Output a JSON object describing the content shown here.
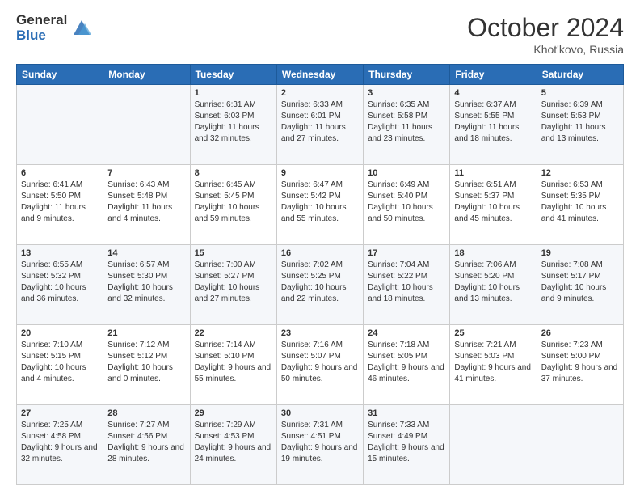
{
  "logo": {
    "general": "General",
    "blue": "Blue"
  },
  "header": {
    "month": "October 2024",
    "location": "Khot'kovo, Russia"
  },
  "weekdays": [
    "Sunday",
    "Monday",
    "Tuesday",
    "Wednesday",
    "Thursday",
    "Friday",
    "Saturday"
  ],
  "weeks": [
    [
      null,
      null,
      {
        "day": 1,
        "sunrise": "6:31 AM",
        "sunset": "6:03 PM",
        "daylight": "11 hours and 32 minutes."
      },
      {
        "day": 2,
        "sunrise": "6:33 AM",
        "sunset": "6:01 PM",
        "daylight": "11 hours and 27 minutes."
      },
      {
        "day": 3,
        "sunrise": "6:35 AM",
        "sunset": "5:58 PM",
        "daylight": "11 hours and 23 minutes."
      },
      {
        "day": 4,
        "sunrise": "6:37 AM",
        "sunset": "5:55 PM",
        "daylight": "11 hours and 18 minutes."
      },
      {
        "day": 5,
        "sunrise": "6:39 AM",
        "sunset": "5:53 PM",
        "daylight": "11 hours and 13 minutes."
      }
    ],
    [
      {
        "day": 6,
        "sunrise": "6:41 AM",
        "sunset": "5:50 PM",
        "daylight": "11 hours and 9 minutes."
      },
      {
        "day": 7,
        "sunrise": "6:43 AM",
        "sunset": "5:48 PM",
        "daylight": "11 hours and 4 minutes."
      },
      {
        "day": 8,
        "sunrise": "6:45 AM",
        "sunset": "5:45 PM",
        "daylight": "10 hours and 59 minutes."
      },
      {
        "day": 9,
        "sunrise": "6:47 AM",
        "sunset": "5:42 PM",
        "daylight": "10 hours and 55 minutes."
      },
      {
        "day": 10,
        "sunrise": "6:49 AM",
        "sunset": "5:40 PM",
        "daylight": "10 hours and 50 minutes."
      },
      {
        "day": 11,
        "sunrise": "6:51 AM",
        "sunset": "5:37 PM",
        "daylight": "10 hours and 45 minutes."
      },
      {
        "day": 12,
        "sunrise": "6:53 AM",
        "sunset": "5:35 PM",
        "daylight": "10 hours and 41 minutes."
      }
    ],
    [
      {
        "day": 13,
        "sunrise": "6:55 AM",
        "sunset": "5:32 PM",
        "daylight": "10 hours and 36 minutes."
      },
      {
        "day": 14,
        "sunrise": "6:57 AM",
        "sunset": "5:30 PM",
        "daylight": "10 hours and 32 minutes."
      },
      {
        "day": 15,
        "sunrise": "7:00 AM",
        "sunset": "5:27 PM",
        "daylight": "10 hours and 27 minutes."
      },
      {
        "day": 16,
        "sunrise": "7:02 AM",
        "sunset": "5:25 PM",
        "daylight": "10 hours and 22 minutes."
      },
      {
        "day": 17,
        "sunrise": "7:04 AM",
        "sunset": "5:22 PM",
        "daylight": "10 hours and 18 minutes."
      },
      {
        "day": 18,
        "sunrise": "7:06 AM",
        "sunset": "5:20 PM",
        "daylight": "10 hours and 13 minutes."
      },
      {
        "day": 19,
        "sunrise": "7:08 AM",
        "sunset": "5:17 PM",
        "daylight": "10 hours and 9 minutes."
      }
    ],
    [
      {
        "day": 20,
        "sunrise": "7:10 AM",
        "sunset": "5:15 PM",
        "daylight": "10 hours and 4 minutes."
      },
      {
        "day": 21,
        "sunrise": "7:12 AM",
        "sunset": "5:12 PM",
        "daylight": "10 hours and 0 minutes."
      },
      {
        "day": 22,
        "sunrise": "7:14 AM",
        "sunset": "5:10 PM",
        "daylight": "9 hours and 55 minutes."
      },
      {
        "day": 23,
        "sunrise": "7:16 AM",
        "sunset": "5:07 PM",
        "daylight": "9 hours and 50 minutes."
      },
      {
        "day": 24,
        "sunrise": "7:18 AM",
        "sunset": "5:05 PM",
        "daylight": "9 hours and 46 minutes."
      },
      {
        "day": 25,
        "sunrise": "7:21 AM",
        "sunset": "5:03 PM",
        "daylight": "9 hours and 41 minutes."
      },
      {
        "day": 26,
        "sunrise": "7:23 AM",
        "sunset": "5:00 PM",
        "daylight": "9 hours and 37 minutes."
      }
    ],
    [
      {
        "day": 27,
        "sunrise": "7:25 AM",
        "sunset": "4:58 PM",
        "daylight": "9 hours and 32 minutes."
      },
      {
        "day": 28,
        "sunrise": "7:27 AM",
        "sunset": "4:56 PM",
        "daylight": "9 hours and 28 minutes."
      },
      {
        "day": 29,
        "sunrise": "7:29 AM",
        "sunset": "4:53 PM",
        "daylight": "9 hours and 24 minutes."
      },
      {
        "day": 30,
        "sunrise": "7:31 AM",
        "sunset": "4:51 PM",
        "daylight": "9 hours and 19 minutes."
      },
      {
        "day": 31,
        "sunrise": "7:33 AM",
        "sunset": "4:49 PM",
        "daylight": "9 hours and 15 minutes."
      },
      null,
      null
    ]
  ],
  "labels": {
    "sunrise": "Sunrise:",
    "sunset": "Sunset:",
    "daylight": "Daylight:"
  }
}
